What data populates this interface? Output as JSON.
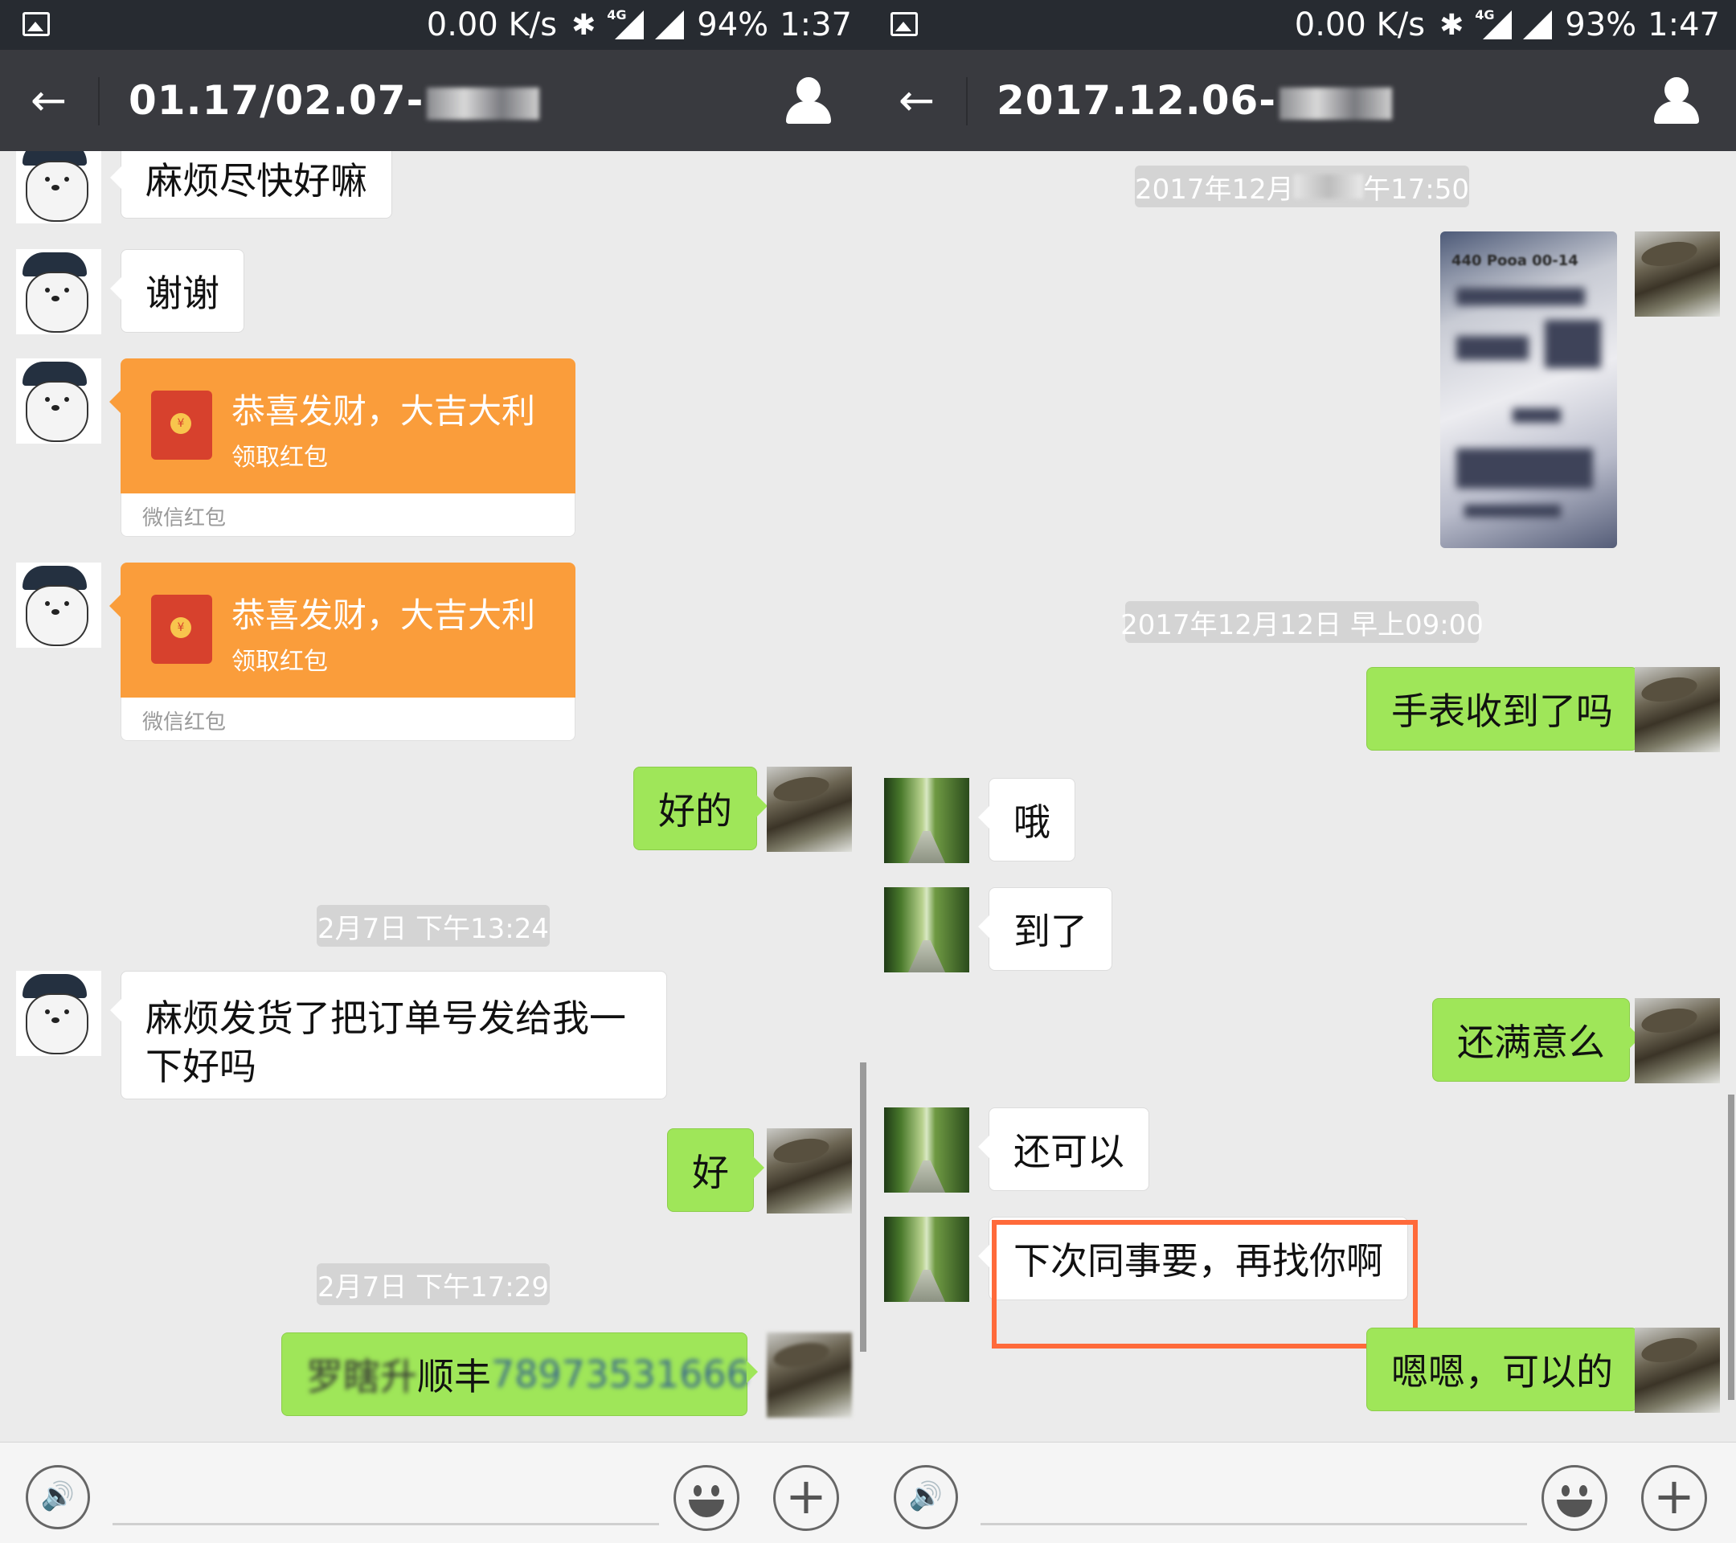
{
  "left": {
    "status": {
      "speed": "0.00 K/s",
      "bluetooth": "✱",
      "net": "4G",
      "battery": "94%",
      "time": "1:37"
    },
    "header": {
      "back": "←",
      "title": "01.17/02.07-"
    },
    "messages": {
      "m1": "麻烦尽快好嘛",
      "m2": "谢谢",
      "rp1": {
        "text": "恭喜发财，大吉大利",
        "sub": "领取红包",
        "footer": "微信红包"
      },
      "rp2": {
        "text": "恭喜发财，大吉大利",
        "sub": "领取红包",
        "footer": "微信红包"
      },
      "m3": "好的",
      "ts1": "2月7日 下午13:24",
      "m4": "麻烦发货了把订单号发给我一下好吗",
      "m5": "好",
      "ts2": "2月7日 下午17:29",
      "m6_prefix": "罗瞎升",
      "m6_mid": " 顺丰 ",
      "m6_num": "78973531666"
    },
    "input": {
      "voice": "🔊",
      "plus": "+"
    }
  },
  "right": {
    "status": {
      "speed": "0.00 K/s",
      "bluetooth": "✱",
      "net": "4G",
      "battery": "93%",
      "time": "1:47"
    },
    "header": {
      "back": "←",
      "title": "2017.12.06-"
    },
    "messages": {
      "ts1_a": "2017年12月",
      "ts1_b": "午17:50",
      "photo_hdr": "440 Pooa 00-14",
      "ts2": "2017年12月12日 早上09:00",
      "m1": "手表收到了吗",
      "m2": "哦",
      "m3": "到了",
      "m4": "还满意么",
      "m5": "还可以",
      "m6": "下次同事要，再找你啊",
      "m7": "嗯嗯，可以的"
    },
    "input": {
      "voice": "🔊",
      "plus": "+"
    }
  }
}
